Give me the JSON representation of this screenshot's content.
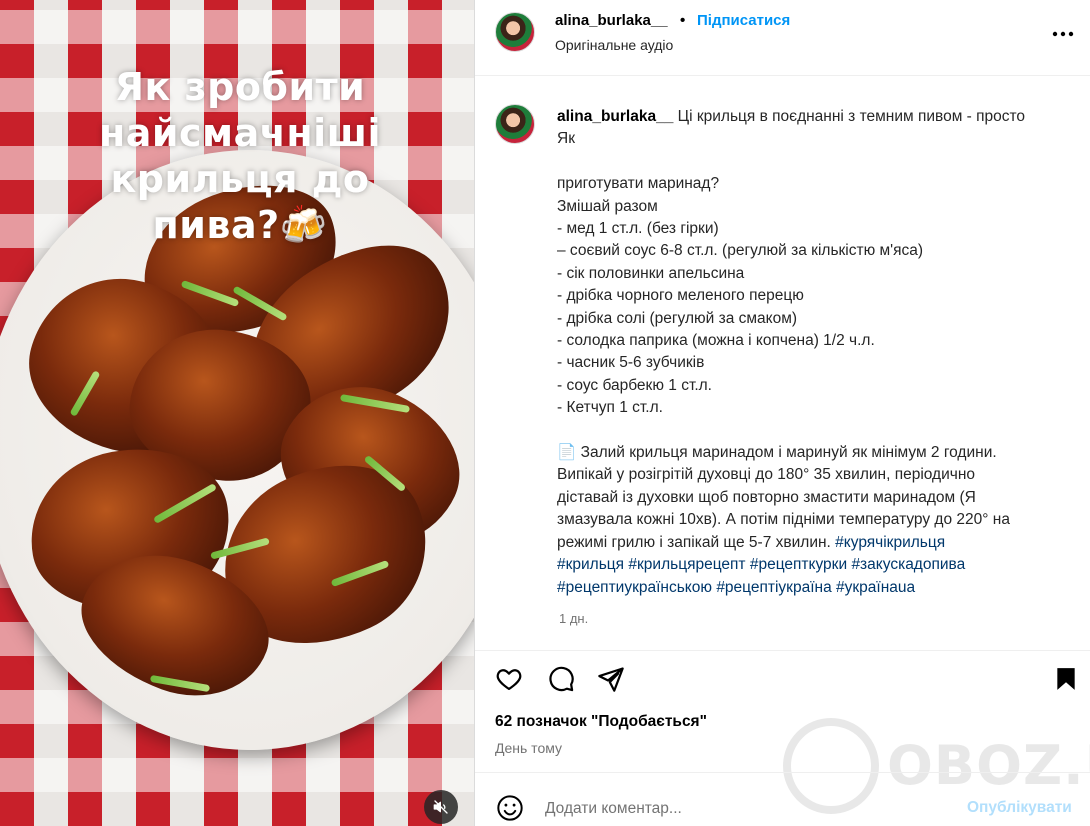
{
  "header": {
    "username": "alina_burlaka__",
    "dot": "•",
    "follow_label": "Підписатися",
    "audio_label": "Оригінальне аудіо"
  },
  "media": {
    "overlay_title_lines": [
      "Як зробити",
      "найсмачніші",
      "крильця до",
      "пива?🍻"
    ]
  },
  "caption": {
    "username": "alina_burlaka__",
    "first_line": " Ці крильця в поєднанні з темним пивом - просто",
    "second_line": "Як",
    "lines_block1": [
      "приготувати маринад?",
      "Змішай разом",
      "- мед 1 ст.л. (без гірки)",
      "– соєвий соус 6-8 ст.л. (регулюй за кількістю м'яса)",
      "- сік половинки апельсина",
      "- дрібка чорного меленого перецю",
      "- дрібка солі (регулюй за смаком)",
      "- солодка паприка (можна і копчена) 1/2 ч.л.",
      "- часник 5-6 зубчиків",
      "- соус барбекю 1 ст.л.",
      "- Кетчуп 1 ст.л."
    ],
    "lines_block2": [
      "📄 Залий крильця маринадом і маринуй як мінімум 2 години.",
      "Випікай у розігрітій духовці до 180° 35 хвилин, періодично",
      "діставай із духовки щоб повторно змастити маринадом (Я",
      "змазувала кожні 10хв). А потім підніми температуру до 220° на"
    ],
    "last_text": "режимі грилю і запікай ще 5-7 хвилин. ",
    "hashtags_line1": "#курячікрильця",
    "hashtags_line2": [
      "#крильця",
      "#крильцярецепт",
      "#рецепткурки",
      "#закускадопива"
    ],
    "hashtags_line3": [
      "#рецептиукраїнською",
      "#рецептіукраїна",
      "#українаua"
    ],
    "time": "1 дн."
  },
  "actions": {
    "icons": [
      "heart-icon",
      "comment-icon",
      "share-icon",
      "bookmark-icon"
    ]
  },
  "likes": "62 позначок \"Подобається\"",
  "date": "День тому",
  "comment": {
    "placeholder": "Додати коментар...",
    "post_label": "Опублікувати"
  },
  "watermark": {
    "text": "OBOZ.UA"
  },
  "colors": {
    "link": "#0095f6",
    "hashtag": "#00376b",
    "post_disabled": "#b2dffc",
    "muted_text": "#737373"
  }
}
